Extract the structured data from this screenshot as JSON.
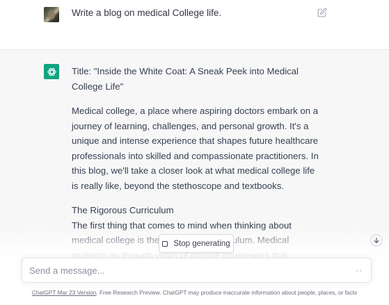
{
  "user_message": {
    "text": "Write a blog on medical College life."
  },
  "assistant_message": {
    "paragraphs": [
      "Title: \"Inside the White Coat: A Sneak Peek into Medical College Life\"",
      "Medical college, a place where aspiring doctors embark on a journey of learning, challenges, and personal growth. It's a unique and intense experience that shapes future healthcare professionals into skilled and compassionate practitioners. In this blog, we'll take a closer look at what medical college life is really like, beyond the stethoscope and textbooks.",
      "The Rigorous Curriculum",
      "The first thing that comes to mind when thinking about medical college is the demanding curriculum. Medical students go through years of intense coursework that includes anatomy,"
    ]
  },
  "controls": {
    "stop_generating_label": "Stop generating"
  },
  "composer": {
    "placeholder": "Send a message..."
  },
  "footer": {
    "version_link": "ChatGPT Mar 23 Version",
    "disclaimer": ". Free Research Preview. ChatGPT may produce inaccurate information about people, places, or facts"
  },
  "icons": {
    "edit": "edit-icon",
    "assistant_logo": "openai-logo-icon",
    "stop": "stop-icon",
    "scroll_down": "arrow-down-icon",
    "more": "dots-icon"
  },
  "colors": {
    "brand_green": "#10a37f",
    "assistant_bg": "#f7f7f8"
  }
}
